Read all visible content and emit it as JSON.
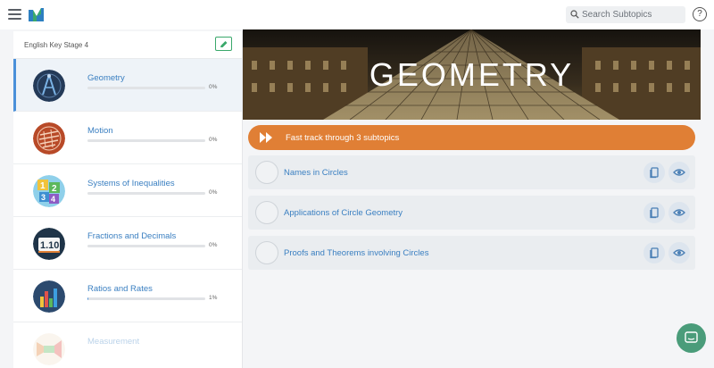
{
  "header": {
    "search_placeholder": "Search Subtopics",
    "help_label": "?"
  },
  "sidebar": {
    "course": "English Key Stage 4",
    "topics": [
      {
        "name": "Geometry",
        "progress": 0,
        "progress_label": "0%",
        "icon": "compass-icon"
      },
      {
        "name": "Motion",
        "progress": 0,
        "progress_label": "0%",
        "icon": "motion-icon"
      },
      {
        "name": "Systems of Inequalities",
        "progress": 0,
        "progress_label": "0%",
        "icon": "number-blocks-icon"
      },
      {
        "name": "Fractions and Decimals",
        "progress": 0,
        "progress_label": "0%",
        "icon": "decimal-icon"
      },
      {
        "name": "Ratios and Rates",
        "progress": 1,
        "progress_label": "1%",
        "icon": "bar-chart-icon"
      },
      {
        "name": "Measurement",
        "progress": 0,
        "progress_label": "",
        "icon": "measurement-icon"
      }
    ]
  },
  "main": {
    "hero_title": "GEOMETRY",
    "fasttrack_label": "Fast track through 3 subtopics",
    "subtopics": [
      {
        "name": "Names in Circles"
      },
      {
        "name": "Applications of Circle Geometry"
      },
      {
        "name": "Proofs and Theorems involving Circles"
      }
    ]
  },
  "colors": {
    "accent_blue": "#3a7fc1",
    "fasttrack_orange": "#e07f35",
    "active_border": "#4a90d9",
    "chat_green": "#4a9c7a",
    "edit_green": "#3aa86b"
  }
}
